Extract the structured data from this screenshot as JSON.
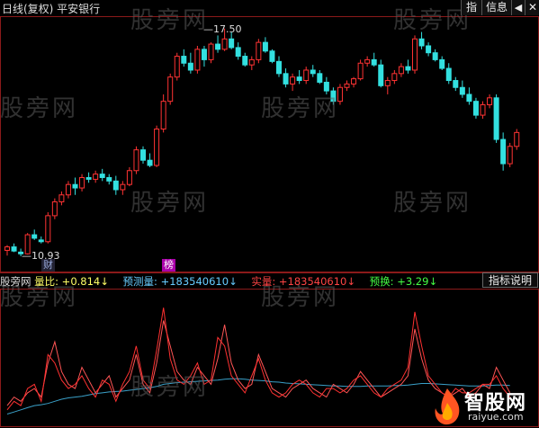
{
  "header": {
    "title": "日线(复权) 平安银行",
    "btn_zhi": "指",
    "btn_info": "信息",
    "btn_arrow": "◀",
    "btn_close": "✕"
  },
  "watermark": "股旁网",
  "price_labels": {
    "high": "17.50",
    "low": "10.93"
  },
  "tags": {
    "cai": "财",
    "bang": "榜"
  },
  "indicator": {
    "name": "股旁网",
    "volume_ratio": "量比: +0.814",
    "predicted_volume": "预测量: +183540610",
    "actual_volume": "实量: +183540610",
    "predicted_turnover": "预换: +3.29",
    "desc_button": "指标说明",
    "colors": {
      "ratio": "#ffff66",
      "predicted": "#66ccff",
      "actual": "#ff4444",
      "turnover": "#44ff44"
    }
  },
  "logo": {
    "main": "智股网",
    "sub": "raiyue.com"
  },
  "colors": {
    "up": "#ff3333",
    "down": "#33e0e0",
    "grid": "#8b1a1a"
  },
  "candles": [
    [
      11.1,
      11.25,
      10.95,
      11.2
    ],
    [
      11.2,
      11.3,
      11.05,
      11.08
    ],
    [
      11.05,
      11.15,
      10.93,
      11.0
    ],
    [
      11.0,
      11.6,
      10.98,
      11.55
    ],
    [
      11.55,
      11.7,
      11.4,
      11.45
    ],
    [
      11.4,
      11.5,
      11.3,
      11.35
    ],
    [
      11.35,
      12.2,
      11.3,
      12.1
    ],
    [
      12.1,
      12.6,
      12.0,
      12.5
    ],
    [
      12.5,
      12.8,
      12.4,
      12.7
    ],
    [
      12.7,
      13.1,
      12.6,
      13.0
    ],
    [
      13.0,
      13.2,
      12.7,
      12.9
    ],
    [
      12.9,
      13.3,
      12.8,
      13.2
    ],
    [
      13.2,
      13.35,
      13.05,
      13.15
    ],
    [
      13.15,
      13.4,
      13.05,
      13.3
    ],
    [
      13.3,
      13.45,
      13.1,
      13.2
    ],
    [
      13.2,
      13.3,
      13.0,
      13.1
    ],
    [
      13.1,
      13.25,
      12.7,
      12.85
    ],
    [
      12.85,
      13.1,
      12.7,
      13.0
    ],
    [
      13.0,
      13.5,
      12.95,
      13.4
    ],
    [
      13.4,
      14.1,
      13.3,
      14.0
    ],
    [
      14.0,
      14.1,
      13.6,
      13.7
    ],
    [
      13.7,
      13.9,
      13.5,
      13.55
    ],
    [
      13.55,
      14.7,
      13.5,
      14.6
    ],
    [
      14.6,
      15.6,
      14.5,
      15.4
    ],
    [
      15.4,
      16.2,
      15.3,
      16.1
    ],
    [
      16.1,
      16.8,
      16.0,
      16.7
    ],
    [
      16.7,
      16.9,
      16.4,
      16.5
    ],
    [
      16.5,
      16.8,
      16.2,
      16.3
    ],
    [
      16.3,
      17.0,
      16.2,
      16.9
    ],
    [
      16.9,
      17.0,
      16.4,
      16.6
    ],
    [
      16.6,
      17.1,
      16.5,
      17.05
    ],
    [
      17.05,
      17.3,
      16.8,
      16.9
    ],
    [
      16.9,
      17.5,
      16.85,
      17.2
    ],
    [
      17.2,
      17.4,
      16.9,
      16.95
    ],
    [
      16.95,
      17.1,
      16.6,
      16.7
    ],
    [
      16.7,
      16.8,
      16.4,
      16.45
    ],
    [
      16.45,
      16.7,
      16.3,
      16.6
    ],
    [
      16.6,
      17.2,
      16.5,
      17.1
    ],
    [
      17.1,
      17.25,
      16.8,
      16.85
    ],
    [
      16.85,
      16.9,
      16.5,
      16.55
    ],
    [
      16.55,
      16.7,
      16.1,
      16.2
    ],
    [
      16.2,
      16.35,
      15.8,
      15.9
    ],
    [
      15.9,
      16.2,
      15.7,
      16.1
    ],
    [
      16.1,
      16.3,
      15.9,
      16.0
    ],
    [
      16.0,
      16.4,
      15.9,
      16.3
    ],
    [
      16.3,
      16.45,
      16.1,
      16.2
    ],
    [
      16.2,
      16.3,
      15.9,
      15.95
    ],
    [
      15.95,
      16.1,
      15.6,
      15.7
    ],
    [
      15.7,
      15.8,
      15.3,
      15.4
    ],
    [
      15.4,
      15.9,
      15.3,
      15.8
    ],
    [
      15.8,
      16.0,
      15.7,
      15.9
    ],
    [
      15.9,
      16.1,
      15.8,
      16.05
    ],
    [
      16.05,
      16.6,
      16.0,
      16.5
    ],
    [
      16.5,
      16.7,
      16.4,
      16.6
    ],
    [
      16.6,
      16.8,
      16.4,
      16.45
    ],
    [
      16.45,
      16.6,
      15.8,
      15.85
    ],
    [
      15.85,
      16.1,
      15.6,
      16.0
    ],
    [
      16.0,
      16.3,
      15.9,
      16.2
    ],
    [
      16.2,
      16.5,
      16.1,
      16.4
    ],
    [
      16.4,
      16.6,
      16.2,
      16.3
    ],
    [
      16.3,
      17.3,
      16.2,
      17.2
    ],
    [
      17.2,
      17.4,
      16.9,
      17.0
    ],
    [
      17.0,
      17.1,
      16.7,
      16.8
    ],
    [
      16.8,
      16.9,
      16.55,
      16.6
    ],
    [
      16.6,
      16.7,
      16.3,
      16.35
    ],
    [
      16.35,
      16.5,
      15.9,
      16.0
    ],
    [
      16.0,
      16.1,
      15.7,
      15.8
    ],
    [
      15.8,
      16.0,
      15.5,
      15.6
    ],
    [
      15.6,
      15.8,
      15.3,
      15.4
    ],
    [
      15.4,
      15.5,
      14.9,
      15.0
    ],
    [
      15.0,
      15.4,
      14.9,
      15.3
    ],
    [
      15.3,
      15.6,
      15.2,
      15.5
    ],
    [
      15.5,
      15.6,
      14.2,
      14.3
    ],
    [
      14.3,
      14.5,
      13.4,
      13.6
    ],
    [
      13.6,
      14.2,
      13.5,
      14.1
    ],
    [
      14.1,
      14.6,
      14.0,
      14.5
    ]
  ],
  "series": {
    "ratio": [
      0.4,
      0.6,
      0.5,
      0.7,
      0.8,
      0.6,
      1.4,
      1.9,
      1.2,
      0.9,
      0.8,
      1.3,
      1.0,
      0.7,
      0.9,
      1.1,
      0.6,
      0.8,
      1.0,
      1.6,
      0.9,
      0.7,
      1.4,
      2.4,
      1.8,
      1.2,
      1.0,
      0.9,
      1.3,
      1.1,
      0.9,
      1.5,
      2.3,
      1.4,
      1.0,
      0.8,
      0.9,
      1.6,
      1.2,
      0.8,
      0.7,
      0.6,
      0.8,
      0.9,
      1.0,
      0.8,
      0.7,
      0.6,
      0.9,
      0.8,
      0.7,
      0.9,
      1.2,
      1.0,
      0.8,
      0.6,
      0.7,
      0.8,
      0.9,
      1.1,
      2.2,
      1.5,
      1.0,
      0.8,
      0.7,
      0.6,
      0.7,
      0.8,
      0.6,
      0.7,
      0.9,
      0.8,
      1.3,
      1.0,
      0.7
    ],
    "actual": [
      0.3,
      0.5,
      0.4,
      0.8,
      0.9,
      0.5,
      1.6,
      1.4,
      1.0,
      0.8,
      0.9,
      1.1,
      0.8,
      0.6,
      1.0,
      0.9,
      0.5,
      0.9,
      1.2,
      1.8,
      1.0,
      0.8,
      1.7,
      2.7,
      1.5,
      1.0,
      0.9,
      1.1,
      1.4,
      0.9,
      1.0,
      2.0,
      1.8,
      1.1,
      0.9,
      0.7,
      1.1,
      1.5,
      1.0,
      0.7,
      0.6,
      0.7,
      0.9,
      1.0,
      0.9,
      0.7,
      0.6,
      0.8,
      0.8,
      0.7,
      0.8,
      1.0,
      1.1,
      0.9,
      0.7,
      0.6,
      0.8,
      0.9,
      1.0,
      1.3,
      2.6,
      1.8,
      1.1,
      0.9,
      0.7,
      0.6,
      0.8,
      0.7,
      0.7,
      0.8,
      0.9,
      0.9,
      1.1,
      0.8,
      0.6
    ],
    "avg": [
      0.2,
      0.25,
      0.3,
      0.35,
      0.4,
      0.42,
      0.45,
      0.5,
      0.55,
      0.58,
      0.6,
      0.62,
      0.65,
      0.68,
      0.7,
      0.72,
      0.73,
      0.74,
      0.76,
      0.78,
      0.8,
      0.82,
      0.85,
      0.9,
      0.92,
      0.94,
      0.95,
      0.96,
      0.97,
      0.98,
      0.99,
      1.0,
      1.02,
      1.03,
      1.03,
      1.02,
      1.0,
      0.99,
      0.98,
      0.96,
      0.95,
      0.93,
      0.92,
      0.91,
      0.9,
      0.89,
      0.88,
      0.87,
      0.86,
      0.86,
      0.85,
      0.85,
      0.85,
      0.86,
      0.86,
      0.86,
      0.86,
      0.87,
      0.87,
      0.88,
      0.9,
      0.92,
      0.92,
      0.91,
      0.9,
      0.89,
      0.88,
      0.87,
      0.86,
      0.86,
      0.86,
      0.87,
      0.88,
      0.88,
      0.87
    ]
  }
}
